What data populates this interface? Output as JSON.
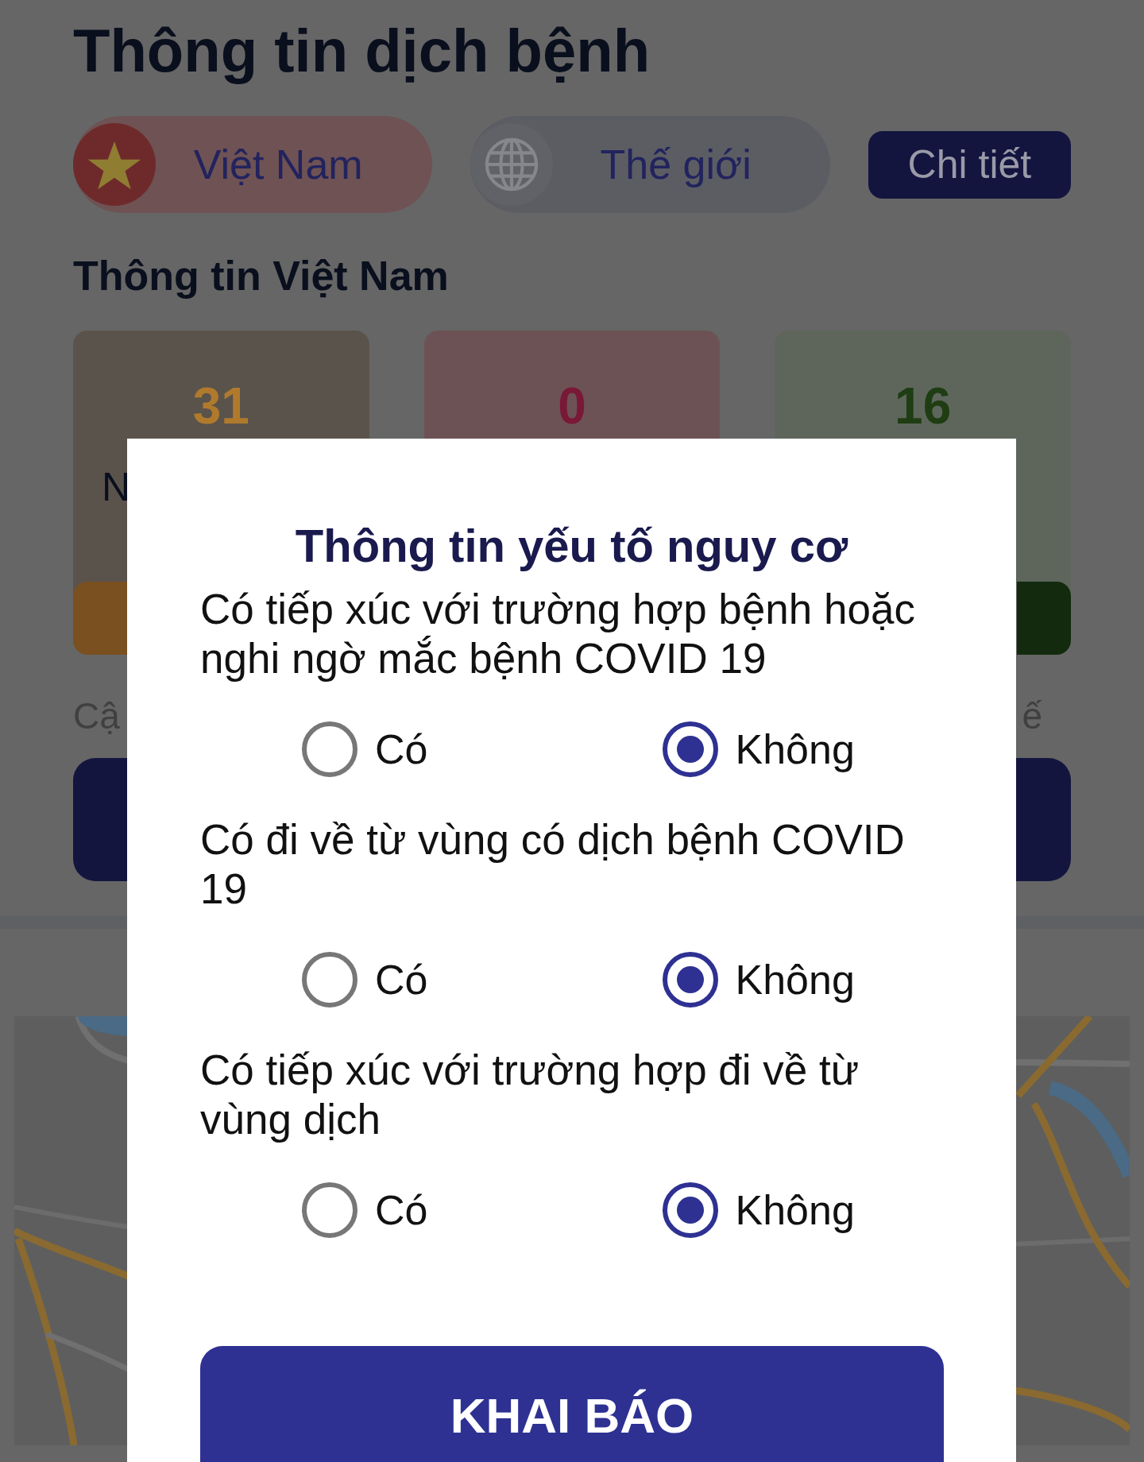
{
  "header": {
    "title": "Thông tin dịch bệnh"
  },
  "scope_tabs": [
    {
      "label": "Việt Nam",
      "selected": true,
      "kind": "flag"
    },
    {
      "label": "Thế giới",
      "selected": false,
      "kind": "globe"
    }
  ],
  "detail_button": {
    "label": "Chi tiết"
  },
  "section_title": "Thông tin Việt Nam",
  "stats": [
    {
      "value": "31",
      "label": "N",
      "color": "#b07a2c"
    },
    {
      "value": "0",
      "color": "#7a1838"
    },
    {
      "value": "16",
      "color": "#1f3d12"
    }
  ],
  "update_note": {
    "left": "Cậ",
    "right": "ế"
  },
  "dialog": {
    "title": "Thông tin yếu tố nguy cơ",
    "questions": [
      {
        "text": "Có tiếp xúc với trường hợp bệnh hoặc nghi ngờ mắc bệnh COVID 19",
        "options": [
          {
            "label": "Có",
            "selected": false
          },
          {
            "label": "Không",
            "selected": true
          }
        ]
      },
      {
        "text": "Có đi về từ vùng có dịch bệnh COVID 19",
        "options": [
          {
            "label": "Có",
            "selected": false
          },
          {
            "label": "Không",
            "selected": true
          }
        ]
      },
      {
        "text": "Có tiếp xúc với trường hợp đi về từ vùng dịch",
        "options": [
          {
            "label": "Có",
            "selected": false
          },
          {
            "label": "Không",
            "selected": true
          }
        ]
      }
    ],
    "submit": "KHAI BÁO"
  }
}
